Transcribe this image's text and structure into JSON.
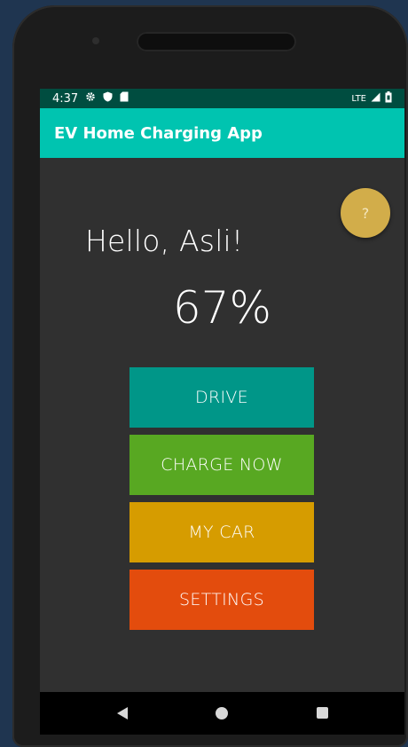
{
  "status_bar": {
    "time": "4:37",
    "network": "LTE",
    "icons": [
      "settings-gear-icon",
      "shield-icon",
      "sd-card-icon",
      "signal-icon",
      "battery-icon"
    ]
  },
  "app_bar": {
    "title": "EV Home Charging App"
  },
  "help_button": {
    "label": "?"
  },
  "greeting": "Hello, Asli!",
  "charge_level": {
    "text": "67%",
    "value": 67
  },
  "menu": {
    "drive": "DRIVE",
    "charge_now": "CHARGE NOW",
    "my_car": "MY CAR",
    "settings": "SETTINGS"
  },
  "colors": {
    "app_bar": "#00c4b0",
    "status_bar": "#004d40",
    "background": "#303030",
    "help_button": "#d2ad4a",
    "drive": "#009688",
    "charge_now": "#58a822",
    "my_car": "#d69c00",
    "settings": "#e34c0d"
  },
  "nav": {
    "icons": [
      "back-icon",
      "home-icon",
      "recents-icon"
    ]
  }
}
